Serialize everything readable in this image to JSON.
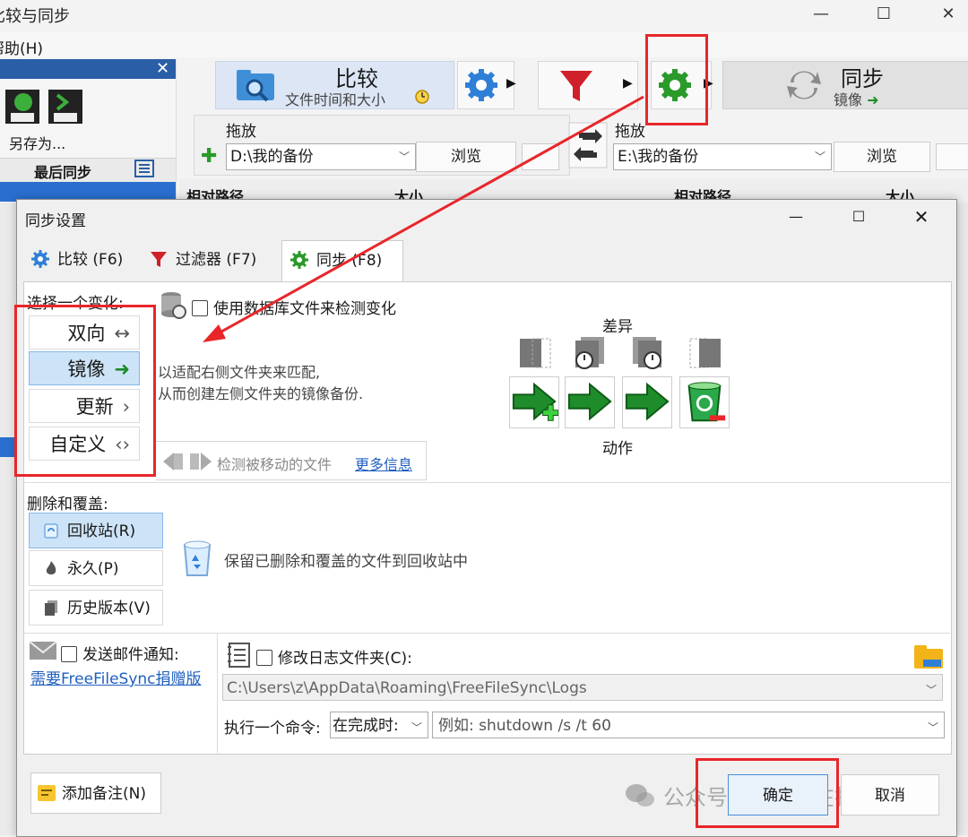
{
  "main_window": {
    "title": "比较与同步",
    "menu_help": "帮助(H)",
    "left_panel": {
      "save_as": "另存为...",
      "last_sync": "最后同步"
    },
    "toolbar": {
      "compare_label": "比较",
      "compare_sub": "文件时间和大小",
      "sync_label": "同步",
      "sync_sub": "镜像"
    },
    "left_folder": {
      "drop_label": "拖放",
      "path": "D:\\我的备份",
      "browse": "浏览"
    },
    "right_folder": {
      "drop_label": "拖放",
      "path": "E:\\我的备份",
      "browse": "浏览"
    },
    "grid": {
      "col_rel_path_left": "相对路径",
      "col_size_left": "大小",
      "col_rel_path_right": "相对路径",
      "col_size_right": "大小"
    }
  },
  "dialog": {
    "title": "同步设置",
    "tabs": [
      {
        "label": "比较 (F6)"
      },
      {
        "label": "过滤器 (F7)"
      },
      {
        "label": "同步 (F8)"
      }
    ],
    "choose_variant_label": "选择一个变化:",
    "variants": [
      {
        "label": "双向",
        "symbol": "↔"
      },
      {
        "label": "镜像",
        "symbol": "➜"
      },
      {
        "label": "更新",
        "symbol": "›"
      },
      {
        "label": "自定义",
        "symbol": "‹›"
      }
    ],
    "database_check_label": "使用数据库文件来检测变化",
    "mirror_desc_line1": "以适配右侧文件夹来匹配,",
    "mirror_desc_line2": "从而创建左侧文件夹的镜像备份.",
    "detect_moved_label": "检测被移动的文件",
    "more_info_link": "更多信息",
    "diff_label": "差异",
    "action_label": "动作",
    "deletion_label": "删除和覆盖:",
    "deletion_options": [
      {
        "label": "回收站(R)"
      },
      {
        "label": "永久(P)"
      },
      {
        "label": "历史版本(V)"
      }
    ],
    "deletion_desc": "保留已删除和覆盖的文件到回收站中",
    "email_check_label": "发送邮件通知:",
    "email_link": "需要FreeFileSync捐赠版",
    "log_check_label": "修改日志文件夹(C):",
    "log_path": "C:\\Users\\z\\AppData\\Roaming\\FreeFileSync\\Logs",
    "cmd_label": "执行一个命令:",
    "cmd_when": "在完成时:",
    "cmd_placeholder": "例如: shutdown /s /t 60",
    "add_note_button": "添加备注(N)",
    "ok_button": "确定",
    "cancel_button": "取消"
  },
  "watermark": "公众号 · 复印机在打印",
  "colors": {
    "accent_red": "#e8262a",
    "selected_bg": "#cde3f7",
    "link_blue": "#1f5fbf",
    "green_arrow": "#1e8c2a"
  }
}
